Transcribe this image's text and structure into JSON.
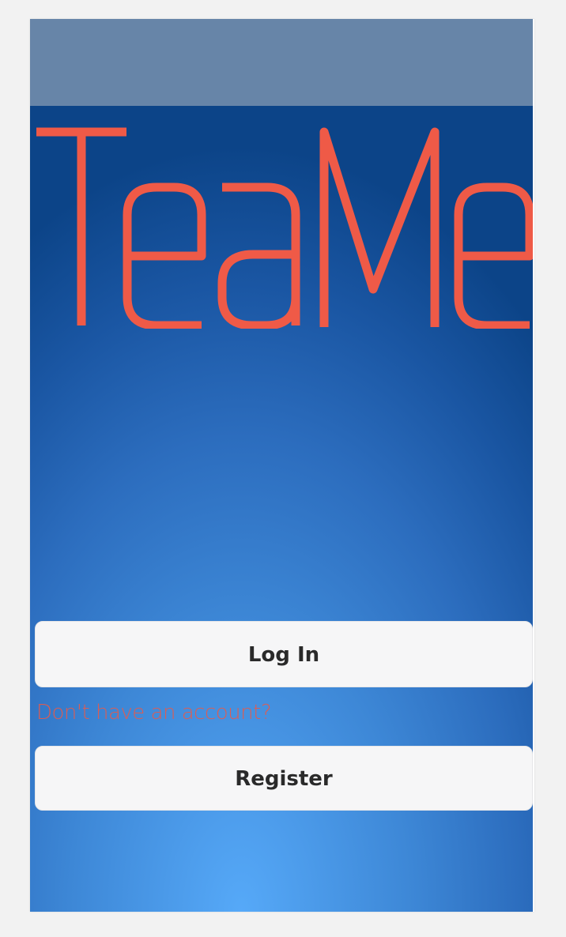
{
  "app": {
    "logo_text": "TeaMe",
    "logo_icon": "teame-wordmark-logo",
    "colors": {
      "status_bar": "#6785a8",
      "background_top": "#0c4488",
      "background_bottom": "#56a9f8",
      "accent": "#e85a4a",
      "button_bg": "#f6f6f7",
      "button_text": "#2a2a2a"
    }
  },
  "auth": {
    "login_label": "Log In",
    "signup_prompt": "Don't have an account?",
    "register_label": "Register"
  }
}
